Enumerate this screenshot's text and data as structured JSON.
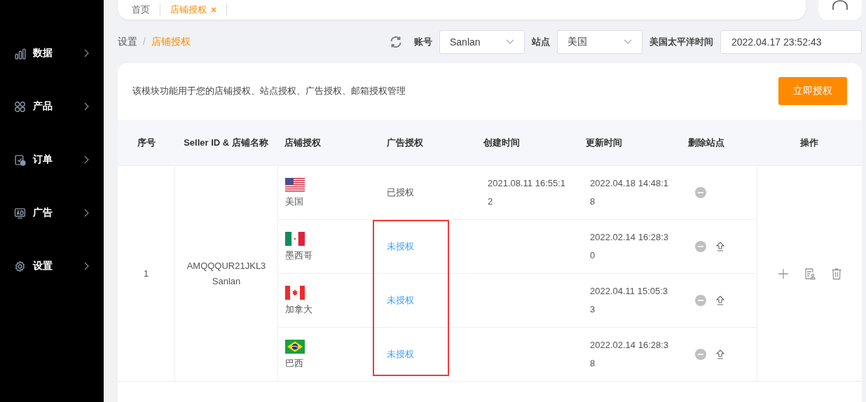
{
  "sidebar": {
    "items": [
      {
        "label": "数据"
      },
      {
        "label": "产品"
      },
      {
        "label": "订单"
      },
      {
        "label": "广告"
      },
      {
        "label": "设置"
      }
    ]
  },
  "breadcrumb_separator": "/",
  "tabs": [
    {
      "label": "首页",
      "selected": false,
      "closable": false
    },
    {
      "label": "店铺授权",
      "selected": true,
      "closable": true
    }
  ],
  "breadcrumb": [
    {
      "label": "设置",
      "selected": false
    },
    {
      "label": "店铺授权",
      "selected": true
    }
  ],
  "filters": {
    "account_label": "账号",
    "account_value": "Sanlan",
    "site_label": "站点",
    "site_value": "美国",
    "time_label": "美国太平洋时间",
    "time_value": "2022.04.17 23:52:43"
  },
  "intro": "该模块功能用于您的店铺授权、站点授权、广告授权、邮箱授权管理",
  "authorize_button": "立即授权",
  "table": {
    "columns": [
      "序号",
      "Seller ID & 店铺名称",
      "店铺授权",
      "广告授权",
      "创建时间",
      "更新时间",
      "删除站点",
      "操作"
    ],
    "rows": [
      {
        "index": "1",
        "seller_id": "AMQQQUR21JKL3",
        "store_name": "Sanlan",
        "sites": [
          {
            "country": "美国",
            "ad_auth": "已授权",
            "authorized": true,
            "created": "2021.08.11 16:55:12",
            "updated": "2022.04.18 14:48:18",
            "upload": false
          },
          {
            "country": "墨西哥",
            "ad_auth": "未授权",
            "authorized": false,
            "updated": "2022.02.14 16:28:30",
            "upload": true
          },
          {
            "country": "加拿大",
            "ad_auth": "未授权",
            "authorized": false,
            "updated": "2022.04.11 15:05:33",
            "upload": true
          },
          {
            "country": "巴西",
            "ad_auth": "未授权",
            "authorized": false,
            "updated": "2022.02.14 16:28:38",
            "upload": true
          }
        ]
      }
    ]
  },
  "highlight": {
    "shown": true
  }
}
